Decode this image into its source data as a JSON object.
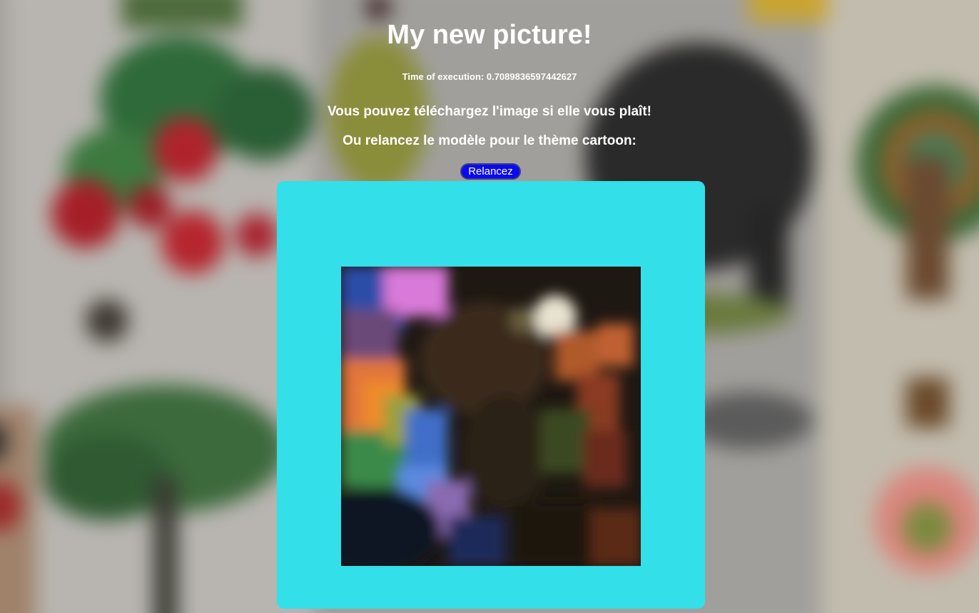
{
  "page": {
    "title": "My new picture!",
    "execution_time": "Time of execution: 0.7089836597442627",
    "download_message": "Vous pouvez téléchargez l'image si elle vous plaît!",
    "rerun_message": "Ou relancez le modèle pour le thème cartoon:",
    "rerun_button_label": "Relancez"
  },
  "colors": {
    "frame_background": "#33dfe8",
    "button_background": "#0a0aee",
    "text": "#ffffff"
  }
}
